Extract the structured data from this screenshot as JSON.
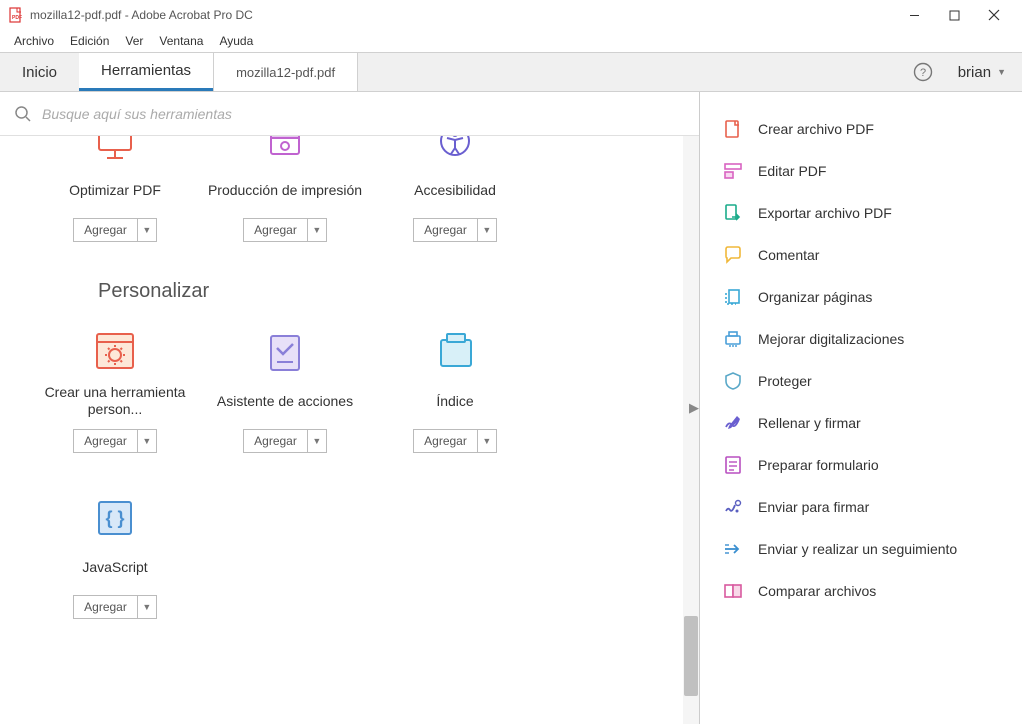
{
  "window": {
    "title": "mozilla12-pdf.pdf - Adobe Acrobat Pro DC"
  },
  "menubar": [
    "Archivo",
    "Edición",
    "Ver",
    "Ventana",
    "Ayuda"
  ],
  "tabs": {
    "home": "Inicio",
    "tools": "Herramientas",
    "doc": "mozilla12-pdf.pdf"
  },
  "user": "brian",
  "search": {
    "placeholder": "Busque aquí sus herramientas"
  },
  "add_label": "Agregar",
  "section_customize": "Personalizar",
  "tools_row1": [
    {
      "name": "Optimizar PDF",
      "icon": "optimize"
    },
    {
      "name": "Producción de impresión",
      "icon": "print-prod"
    },
    {
      "name": "Accesibilidad",
      "icon": "accessibility"
    }
  ],
  "tools_row2": [
    {
      "name": "Crear una herramienta person...",
      "icon": "custom-tool"
    },
    {
      "name": "Asistente de acciones",
      "icon": "action-wizard"
    },
    {
      "name": "Índice",
      "icon": "index"
    }
  ],
  "tools_row3": [
    {
      "name": "JavaScript",
      "icon": "javascript"
    }
  ],
  "sidebar": [
    {
      "label": "Crear archivo PDF",
      "icon": "create-pdf",
      "color": "#e8604c"
    },
    {
      "label": "Editar PDF",
      "icon": "edit-pdf",
      "color": "#d963c1"
    },
    {
      "label": "Exportar archivo PDF",
      "icon": "export-pdf",
      "color": "#1aab8a"
    },
    {
      "label": "Comentar",
      "icon": "comment",
      "color": "#f0b83a"
    },
    {
      "label": "Organizar páginas",
      "icon": "organize",
      "color": "#3aa8d6"
    },
    {
      "label": "Mejorar digitalizaciones",
      "icon": "enhance-scan",
      "color": "#4a9fd8"
    },
    {
      "label": "Proteger",
      "icon": "protect",
      "color": "#5aa8c8"
    },
    {
      "label": "Rellenar y firmar",
      "icon": "fill-sign",
      "color": "#6a5fd0"
    },
    {
      "label": "Preparar formulario",
      "icon": "prepare-form",
      "color": "#b84fc0"
    },
    {
      "label": "Enviar para firmar",
      "icon": "send-sign",
      "color": "#5a5fc0"
    },
    {
      "label": "Enviar y realizar un seguimiento",
      "icon": "send-track",
      "color": "#3a8fd0"
    },
    {
      "label": "Comparar archivos",
      "icon": "compare",
      "color": "#d85a9f"
    }
  ]
}
